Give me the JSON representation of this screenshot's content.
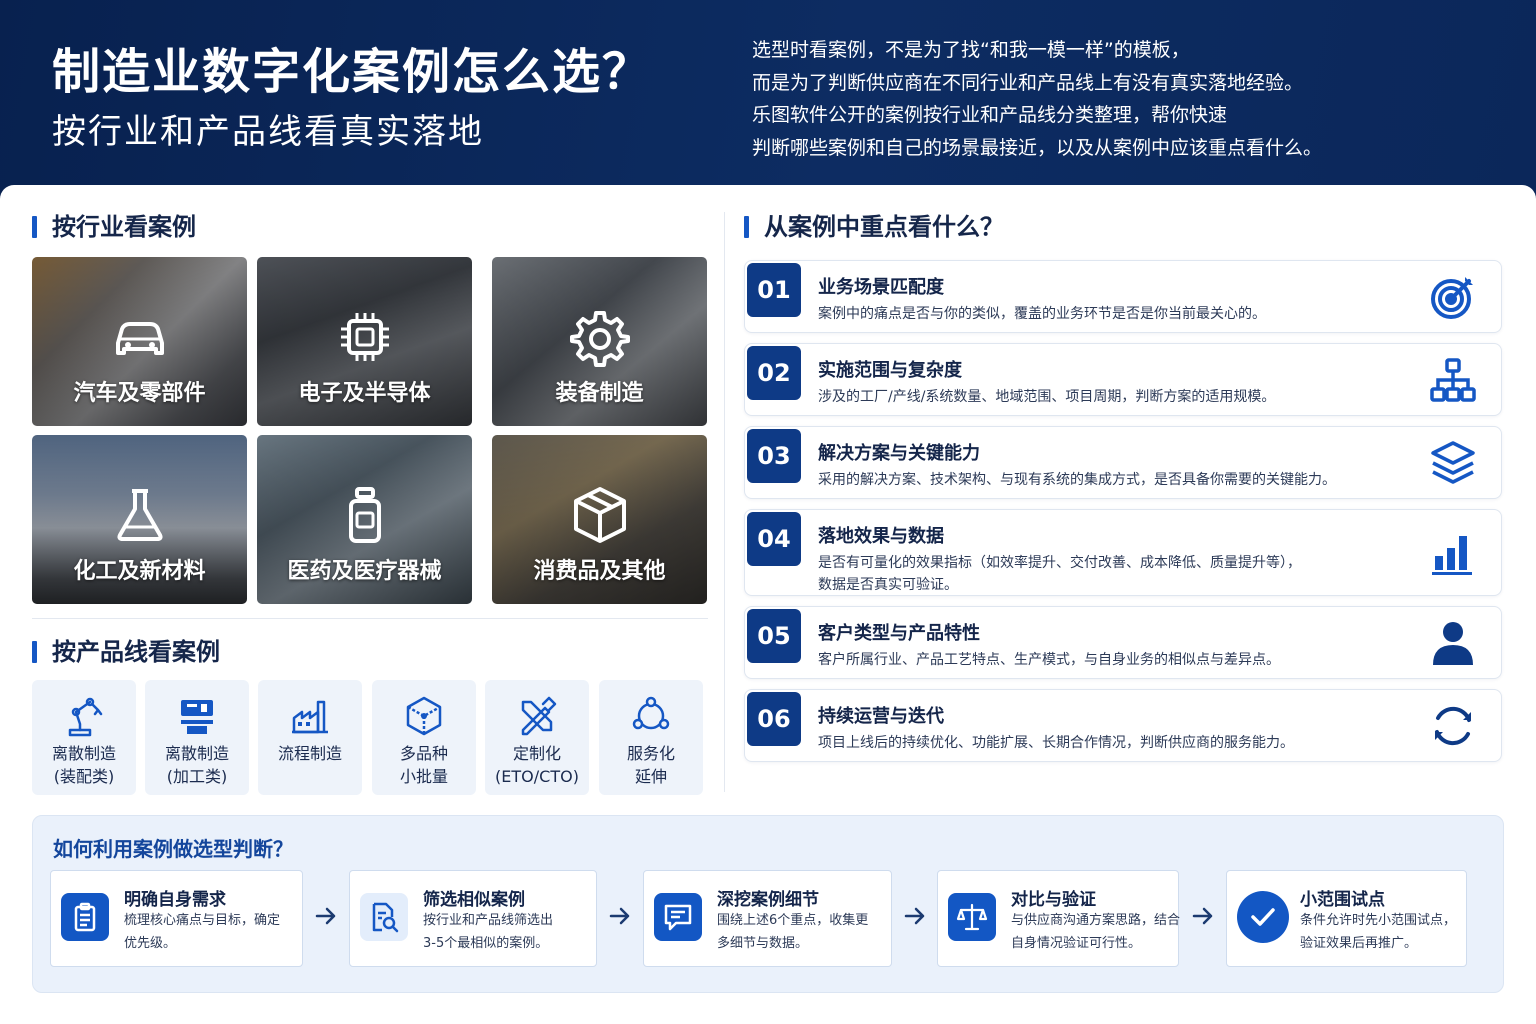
{
  "header": {
    "title": "制造业数字化案例怎么选？",
    "subtitle": "按行业和产品线看真实落地",
    "intro": [
      "选型时看案例，不是为了找“和我一模一样”的模板，",
      "而是为了判断供应商在不同行业和产品线上有没有真实落地经验。",
      "乐图软件公开的案例按行业和产品线分类整理，帮你快速",
      "判断哪些案例和自己的场景最接近，以及从案例中应该重点看什么。"
    ]
  },
  "industry": {
    "title": "按行业看案例",
    "tiles": [
      {
        "label": "汽车及零部件",
        "icon": "car-icon"
      },
      {
        "label": "电子及半导体",
        "icon": "chip-icon"
      },
      {
        "label": "装备制造",
        "icon": "gear-icon"
      },
      {
        "label": "化工及新材料",
        "icon": "flask-icon"
      },
      {
        "label": "医药及医疗器械",
        "icon": "medicine-bottle-icon"
      },
      {
        "label": "消费品及其他",
        "icon": "box-icon"
      }
    ]
  },
  "product_lines": {
    "title": "按产品线看案例",
    "items": [
      {
        "line1": "离散制造",
        "line2": "(装配类)",
        "icon": "robot-arm-icon"
      },
      {
        "line1": "离散制造",
        "line2": "(加工类)",
        "icon": "cnc-machine-icon"
      },
      {
        "line1": "流程制造",
        "line2": "",
        "icon": "factory-icon"
      },
      {
        "line1": "多品种",
        "line2": "小批量",
        "icon": "cube-network-icon"
      },
      {
        "line1": "定制化",
        "line2": "(ETO/CTO)",
        "icon": "design-tools-icon"
      },
      {
        "line1": "服务化",
        "line2": "延伸",
        "icon": "service-network-icon"
      }
    ]
  },
  "focus": {
    "title": "从案例中重点看什么？",
    "points": [
      {
        "num": "01",
        "title": "业务场景匹配度",
        "desc": [
          "案例中的痛点是否与你的类似，覆盖的业务环节是否是你当前最关心的。"
        ],
        "icon": "target-icon"
      },
      {
        "num": "02",
        "title": "实施范围与复杂度",
        "desc": [
          "涉及的工厂/产线/系统数量、地域范围、项目周期，判断方案的适用规模。"
        ],
        "icon": "org-chart-icon"
      },
      {
        "num": "03",
        "title": "解决方案与关键能力",
        "desc": [
          "采用的解决方案、技术架构、与现有系统的集成方式，是否具备你需要的关键能力。"
        ],
        "icon": "layers-icon"
      },
      {
        "num": "04",
        "title": "落地效果与数据",
        "desc": [
          "是否有可量化的效果指标（如效率提升、交付改善、成本降低、质量提升等），",
          "数据是否真实可验证。"
        ],
        "icon": "bar-chart-icon"
      },
      {
        "num": "05",
        "title": "客户类型与产品特性",
        "desc": [
          "客户所属行业、产品工艺特点、生产模式，与自身业务的相似点与差异点。"
        ],
        "icon": "user-icon"
      },
      {
        "num": "06",
        "title": "持续运营与迭代",
        "desc": [
          "项目上线后的持续优化、功能扩展、长期合作情况，判断供应商的服务能力。"
        ],
        "icon": "refresh-icon"
      }
    ]
  },
  "howto": {
    "title": "如何利用案例做选型判断？",
    "steps": [
      {
        "title": "明确自身需求",
        "desc": [
          "梳理核心痛点与目标，确定",
          "优先级。"
        ],
        "icon": "clipboard-icon"
      },
      {
        "title": "筛选相似案例",
        "desc": [
          "按行业和产品线筛选出",
          "3-5个最相似的案例。"
        ],
        "icon": "document-search-icon"
      },
      {
        "title": "深挖案例细节",
        "desc": [
          "围绕上述6个重点，收集更",
          "多细节与数据。"
        ],
        "icon": "chat-icon"
      },
      {
        "title": "对比与验证",
        "desc": [
          "与供应商沟通方案思路，结合",
          "自身情况验证可行性。"
        ],
        "icon": "scale-icon"
      },
      {
        "title": "小范围试点",
        "desc": [
          "条件允许时先小范围试点，",
          "验证效果后再推广。"
        ],
        "icon": "check-circle-icon"
      }
    ]
  },
  "colors": {
    "navy": "#0b275a",
    "accent": "#1557c4",
    "number_bg": "#0e3a86",
    "panel_bg": "#eaf1fb"
  }
}
